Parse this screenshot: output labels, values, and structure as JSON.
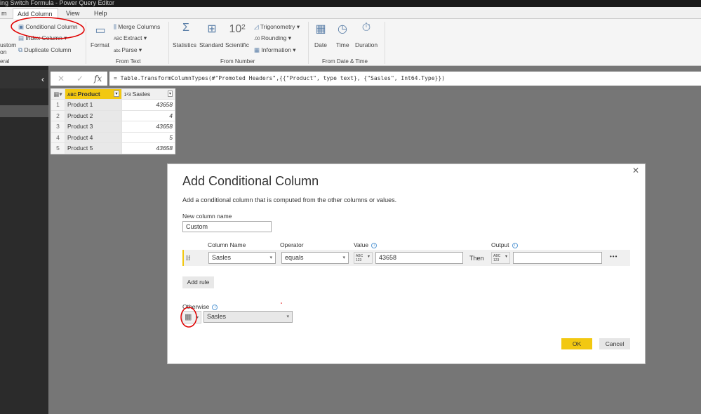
{
  "window": {
    "title": "ing Switch Formula - Power Query Editor"
  },
  "tabs": [
    {
      "label": "m"
    },
    {
      "label": "Add Column",
      "active": true
    },
    {
      "label": "View"
    },
    {
      "label": "Help"
    }
  ],
  "ribbon": {
    "general": {
      "custom_label_1": "ustom",
      "custom_label_2": "on",
      "group": "eral",
      "conditional": "Conditional Column",
      "index": "Index Column",
      "duplicate": "Duplicate Column"
    },
    "from_text": {
      "format": "Format",
      "merge": "Merge Columns",
      "extract": "Extract",
      "parse": "Parse",
      "group": "From Text"
    },
    "from_number": {
      "statistics": "Statistics",
      "standard": "Standard",
      "scientific": "Scientific",
      "trigonometry": "Trigonometry",
      "rounding": "Rounding",
      "information": "Information",
      "group": "From Number"
    },
    "from_date": {
      "date": "Date",
      "time": "Time",
      "duration": "Duration",
      "group": "From Date & Time"
    }
  },
  "sidebar": {
    "collapse": "‹"
  },
  "formula_bar": {
    "cancel": "✕",
    "confirm": "✓",
    "fx": "fx",
    "formula": "= Table.TransformColumnTypes(#\"Promoted Headers\",{{\"Product\", type text}, {\"Sasles\", Int64.Type}})"
  },
  "grid": {
    "columns": [
      {
        "name": "Product",
        "type": "ABC"
      },
      {
        "name": "Sasles",
        "type": "123"
      }
    ],
    "rows": [
      [
        "1",
        "Product 1",
        "43658"
      ],
      [
        "2",
        "Product 2",
        "4"
      ],
      [
        "3",
        "Product 3",
        "43658"
      ],
      [
        "4",
        "Product 4",
        "5"
      ],
      [
        "5",
        "Product 5",
        "43658"
      ]
    ]
  },
  "dialog": {
    "title": "Add Conditional Column",
    "description": "Add a conditional column that is computed from the other columns or values.",
    "new_column_label": "New column name",
    "new_column_value": "Custom",
    "headers": {
      "column_name": "Column Name",
      "operator": "Operator",
      "value": "Value",
      "output": "Output"
    },
    "rule": {
      "if": "If",
      "column": "Sasles",
      "operator": "equals",
      "value_type": "ABC 123",
      "value": "43658",
      "then": "Then",
      "output_type": "ABC 123",
      "output": "",
      "more": "•••"
    },
    "add_rule": "Add rule",
    "otherwise_label": "Otherwise",
    "otherwise_value": "Sasles",
    "ok": "OK",
    "cancel": "Cancel",
    "close": "✕"
  },
  "colors": {
    "accent": "#f2c811",
    "annotation": "#e00000"
  }
}
